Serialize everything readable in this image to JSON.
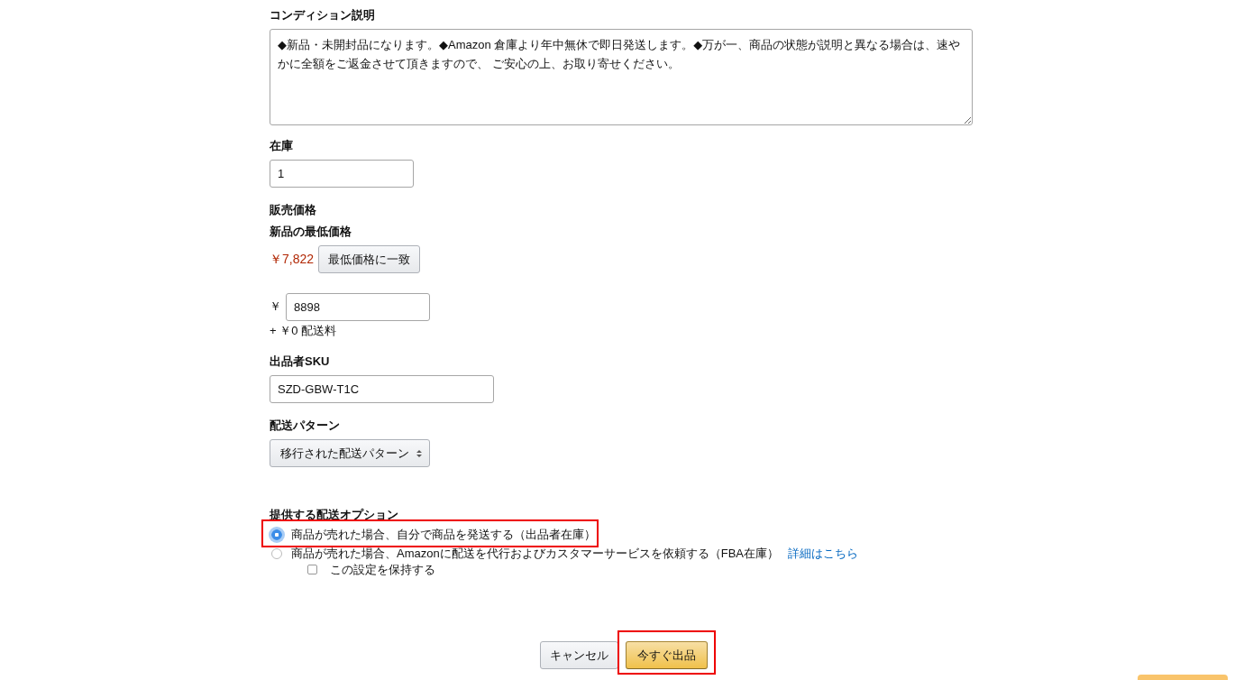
{
  "condition": {
    "label": "コンディション説明",
    "value": "◆新品・未開封品になります。◆Amazon 倉庫より年中無休で即日発送します。◆万が一、商品の状態が説明と異なる場合は、速やかに全額をご返金させて頂きますので、 ご安心の上、お取り寄せください。"
  },
  "stock": {
    "label": "在庫",
    "value": "1"
  },
  "price": {
    "label": "販売価格",
    "lowest_label": "新品の最低価格",
    "lowest_value": "￥7,822",
    "match_button": "最低価格に一致",
    "currency": "￥",
    "value": "8898",
    "shipping": "+ ￥0 配送料"
  },
  "sku": {
    "label": "出品者SKU",
    "value": "SZD-GBW-T1C"
  },
  "shipping_template": {
    "label": "配送パターン",
    "value": "移行された配送パターン"
  },
  "fulfillment": {
    "label": "提供する配送オプション",
    "options": [
      {
        "label": "商品が売れた場合、自分で商品を発送する（出品者在庫）",
        "selected": true,
        "highlighted": true
      },
      {
        "label": "商品が売れた場合、Amazonに配送を代行およびカスタマーサービスを依頼する（FBA在庫）",
        "selected": false,
        "highlighted": false,
        "link": "詳細はこちら"
      }
    ],
    "remember": {
      "label": "この設定を保持する",
      "checked": false
    }
  },
  "buttons": [
    {
      "label": "キャンセル",
      "kind": "secondary",
      "highlighted": false
    },
    {
      "label": "今すぐ出品",
      "kind": "primary",
      "highlighted": true
    }
  ]
}
